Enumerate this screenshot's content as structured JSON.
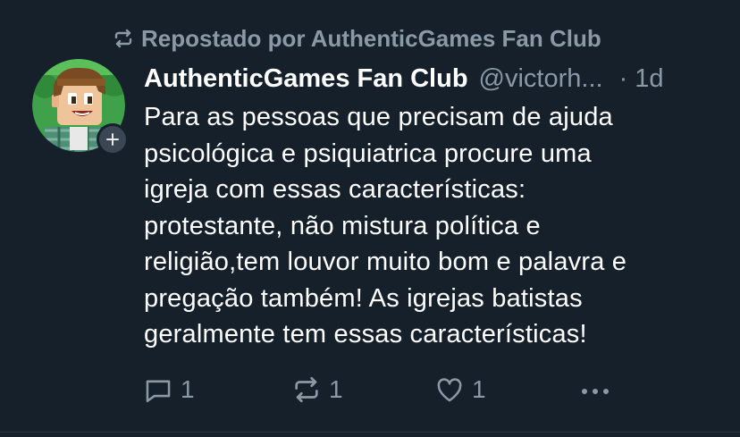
{
  "repost": {
    "icon": "repost-icon",
    "label": "Repostado por AuthenticGames Fan Club"
  },
  "author": {
    "display_name": "AuthenticGames Fan Club",
    "handle": "@victorh...",
    "separator": "·",
    "time": "1d",
    "avatar_icon": "cartoon-avatar",
    "follow_icon": "plus-icon"
  },
  "tweet": {
    "text": "Para as pessoas que precisam de ajuda\npsicológica e psiquiatrica procure uma\nigreja com essas características:\nprotestante, não mistura política e\nreligião,tem louvor muito bom e palavra e\npregação também! As igrejas batistas\ngeralmente tem essas características!"
  },
  "actions": {
    "reply": {
      "icon": "reply-icon",
      "count": "1"
    },
    "retweet": {
      "icon": "retweet-icon",
      "count": "1"
    },
    "like": {
      "icon": "heart-icon",
      "count": "1"
    },
    "more": {
      "icon": "more-icon"
    }
  },
  "colors": {
    "background": "#15202b",
    "text": "#ffffff",
    "muted": "#8b98a5"
  }
}
